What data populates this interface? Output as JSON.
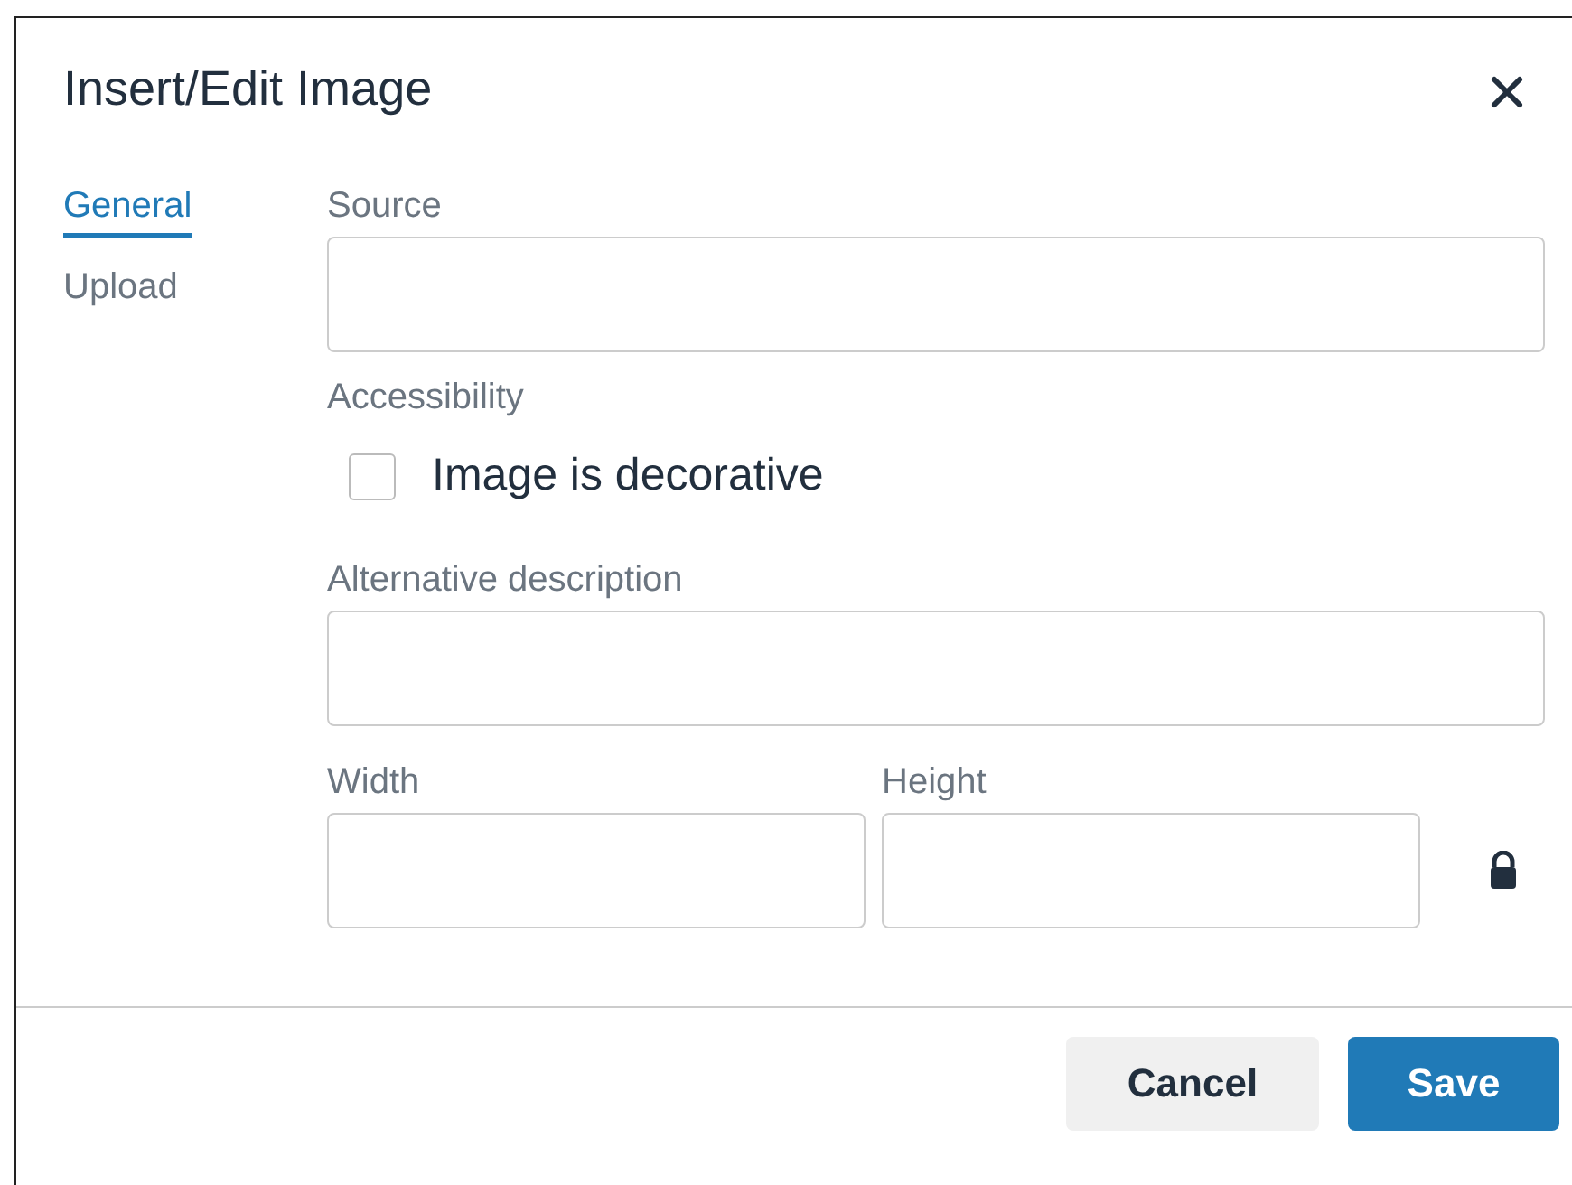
{
  "dialog": {
    "title": "Insert/Edit Image"
  },
  "tabs": [
    {
      "label": "General",
      "selected": true
    },
    {
      "label": "Upload",
      "selected": false
    }
  ],
  "source": {
    "label": "Source"
  },
  "accessibility": {
    "label": "Accessibility",
    "checkbox_label": "Image is decorative",
    "checked": false
  },
  "alt": {
    "label": "Alternative description"
  },
  "width": {
    "label": "Width"
  },
  "height": {
    "label": "Height"
  },
  "constrain_locked": true,
  "buttons": [
    {
      "label": "Cancel",
      "kind": "secondary"
    },
    {
      "label": "Save",
      "kind": "primary"
    }
  ]
}
